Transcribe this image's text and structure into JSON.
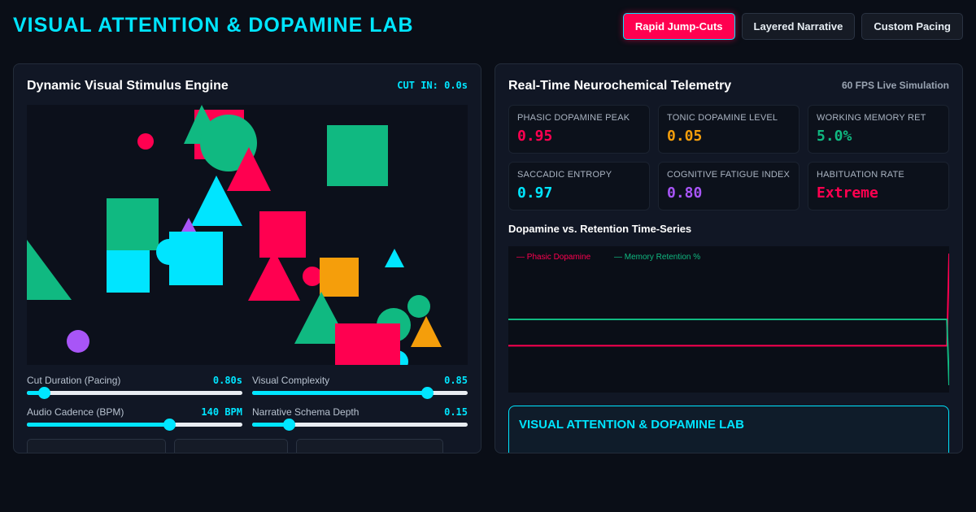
{
  "app_title": "VISUAL ATTENTION & DOPAMINE LAB",
  "modes": [
    {
      "label": "Rapid Jump-Cuts",
      "active": true
    },
    {
      "label": "Layered Narrative",
      "active": false
    },
    {
      "label": "Custom Pacing",
      "active": false
    }
  ],
  "stimulus_panel": {
    "title": "Dynamic Visual Stimulus Engine",
    "cut_timer": "CUT IN: 0.0s"
  },
  "sliders": [
    {
      "label": "Cut Duration (Pacing)",
      "value": "0.80s",
      "fraction": 0.08
    },
    {
      "label": "Visual Complexity",
      "value": "0.85",
      "fraction": 0.81
    },
    {
      "label": "Audio Cadence (BPM)",
      "value": "140 BPM",
      "fraction": 0.66
    },
    {
      "label": "Narrative Schema Depth",
      "value": "0.15",
      "fraction": 0.17
    }
  ],
  "telemetry_panel": {
    "title": "Real-Time Neurochemical Telemetry",
    "fps_label": "60 FPS Live Simulation"
  },
  "metrics": [
    {
      "label": "PHASIC DOPAMINE PEAK",
      "value": "0.95",
      "color": "#ff0050"
    },
    {
      "label": "TONIC DOPAMINE LEVEL",
      "value": "0.05",
      "color": "#f59e0b"
    },
    {
      "label": "WORKING MEMORY RET",
      "value": "5.0%",
      "color": "#10b981"
    },
    {
      "label": "SACCADIC ENTROPY",
      "value": "0.97",
      "color": "#00e5ff"
    },
    {
      "label": "COGNITIVE FATIGUE INDEX",
      "value": "0.80",
      "color": "#a855f7"
    },
    {
      "label": "HABITUATION RATE",
      "value": "Extreme",
      "color": "#ff0050"
    }
  ],
  "timeseries": {
    "title": "Dopamine vs. Retention Time-Series"
  },
  "chart_data": {
    "type": "line",
    "title": "Dopamine vs. Retention Time-Series",
    "xlabel": "",
    "ylabel": "",
    "series": [
      {
        "name": "— Phasic Dopamine",
        "color": "#ff0050",
        "values": [
          0.32,
          0.32,
          0.32,
          0.32,
          0.32,
          0.32,
          0.32,
          0.32,
          0.32,
          0.32,
          0.32,
          0.32,
          0.32,
          0.32,
          0.32,
          0.32,
          0.32,
          0.32,
          0.32,
          0.32,
          0.32,
          0.32,
          0.32,
          0.32,
          0.32,
          0.32,
          0.32,
          0.32,
          0.32,
          0.32,
          0.32,
          0.32,
          0.32,
          0.32,
          0.32,
          0.32,
          0.32,
          0.32,
          0.32,
          0.32,
          0.32,
          0.32,
          0.32,
          0.32,
          0.32,
          0.32,
          0.32,
          0.32,
          0.32,
          0.32,
          0.32,
          0.32,
          0.32,
          0.32,
          0.32,
          0.32,
          0.32,
          0.32,
          0.32,
          0.32,
          0.32,
          0.32,
          0.32,
          0.32,
          0.32,
          0.32,
          0.32,
          0.32,
          0.32,
          0.32,
          0.32,
          0.32,
          0.32,
          0.32,
          0.32,
          0.32,
          0.32,
          0.32,
          0.32,
          0.32,
          0.32,
          0.32,
          0.32,
          0.32,
          0.32,
          0.32,
          0.32,
          0.32,
          0.32,
          0.32,
          0.32,
          0.32,
          0.32,
          0.32,
          0.32,
          0.32,
          0.32,
          0.32,
          0.32,
          0.32,
          0.32,
          0.32,
          0.32,
          0.32,
          0.32,
          0.32,
          0.32,
          0.32,
          0.32,
          0.32,
          0.32,
          0.32,
          0.32,
          0.32,
          0.32,
          0.32,
          0.32,
          0.32,
          0.32,
          0.32,
          0.32,
          0.32,
          0.32,
          0.32,
          0.32,
          0.32,
          0.32,
          0.32,
          0.32,
          0.32,
          0.32,
          0.32,
          0.32,
          0.32,
          0.32,
          0.32,
          0.32,
          0.32,
          0.32,
          0.32,
          0.32,
          0.32,
          0.32,
          0.32,
          0.32,
          0.32,
          0.32,
          0.32,
          0.32,
          0.32,
          0.32,
          0.32,
          0.32,
          0.32,
          0.32,
          0.32,
          0.32,
          0.32,
          0.32,
          0.32,
          0.32,
          0.32,
          0.32,
          0.32,
          0.32,
          0.32,
          0.32,
          0.32,
          0.32,
          0.32,
          0.32,
          0.32,
          0.32,
          0.32,
          0.32,
          0.32,
          0.32,
          0.32,
          0.32,
          0.32,
          0.32,
          0.32,
          0.32,
          0.32,
          0.32,
          0.32,
          0.32,
          0.32,
          0.32,
          0.32,
          0.32,
          0.32,
          0.32,
          0.32,
          0.32,
          0.32,
          0.32,
          0.32,
          0.32,
          0.32,
          0.32,
          0.95
        ]
      },
      {
        "name": "— Memory Retention %",
        "color": "#10b981",
        "values": [
          0.5,
          0.5,
          0.5,
          0.5,
          0.5,
          0.5,
          0.5,
          0.5,
          0.5,
          0.5,
          0.5,
          0.5,
          0.5,
          0.5,
          0.5,
          0.5,
          0.5,
          0.5,
          0.5,
          0.5,
          0.5,
          0.5,
          0.5,
          0.5,
          0.5,
          0.5,
          0.5,
          0.5,
          0.5,
          0.5,
          0.5,
          0.5,
          0.5,
          0.5,
          0.5,
          0.5,
          0.5,
          0.5,
          0.5,
          0.5,
          0.5,
          0.5,
          0.5,
          0.5,
          0.5,
          0.5,
          0.5,
          0.5,
          0.5,
          0.5,
          0.5,
          0.5,
          0.5,
          0.5,
          0.5,
          0.5,
          0.5,
          0.5,
          0.5,
          0.5,
          0.5,
          0.5,
          0.5,
          0.5,
          0.5,
          0.5,
          0.5,
          0.5,
          0.5,
          0.5,
          0.5,
          0.5,
          0.5,
          0.5,
          0.5,
          0.5,
          0.5,
          0.5,
          0.5,
          0.5,
          0.5,
          0.5,
          0.5,
          0.5,
          0.5,
          0.5,
          0.5,
          0.5,
          0.5,
          0.5,
          0.5,
          0.5,
          0.5,
          0.5,
          0.5,
          0.5,
          0.5,
          0.5,
          0.5,
          0.5,
          0.5,
          0.5,
          0.5,
          0.5,
          0.5,
          0.5,
          0.5,
          0.5,
          0.5,
          0.5,
          0.5,
          0.5,
          0.5,
          0.5,
          0.5,
          0.5,
          0.5,
          0.5,
          0.5,
          0.5,
          0.5,
          0.5,
          0.5,
          0.5,
          0.5,
          0.5,
          0.5,
          0.5,
          0.5,
          0.5,
          0.5,
          0.5,
          0.5,
          0.5,
          0.5,
          0.5,
          0.5,
          0.5,
          0.5,
          0.5,
          0.5,
          0.5,
          0.5,
          0.5,
          0.5,
          0.5,
          0.5,
          0.5,
          0.5,
          0.5,
          0.5,
          0.5,
          0.5,
          0.5,
          0.5,
          0.5,
          0.5,
          0.5,
          0.5,
          0.5,
          0.5,
          0.5,
          0.5,
          0.5,
          0.5,
          0.5,
          0.5,
          0.5,
          0.5,
          0.5,
          0.5,
          0.5,
          0.5,
          0.5,
          0.5,
          0.5,
          0.5,
          0.5,
          0.5,
          0.5,
          0.5,
          0.5,
          0.5,
          0.5,
          0.5,
          0.5,
          0.5,
          0.5,
          0.5,
          0.5,
          0.5,
          0.5,
          0.5,
          0.5,
          0.5,
          0.5,
          0.5,
          0.05
        ]
      }
    ]
  },
  "info_box": {
    "title": "VISUAL ATTENTION & DOPAMINE LAB"
  },
  "shape_colors": {
    "red": "#ff0050",
    "green": "#10b981",
    "cyan": "#00e5ff",
    "orange": "#f59e0b",
    "purple": "#a855f7"
  }
}
